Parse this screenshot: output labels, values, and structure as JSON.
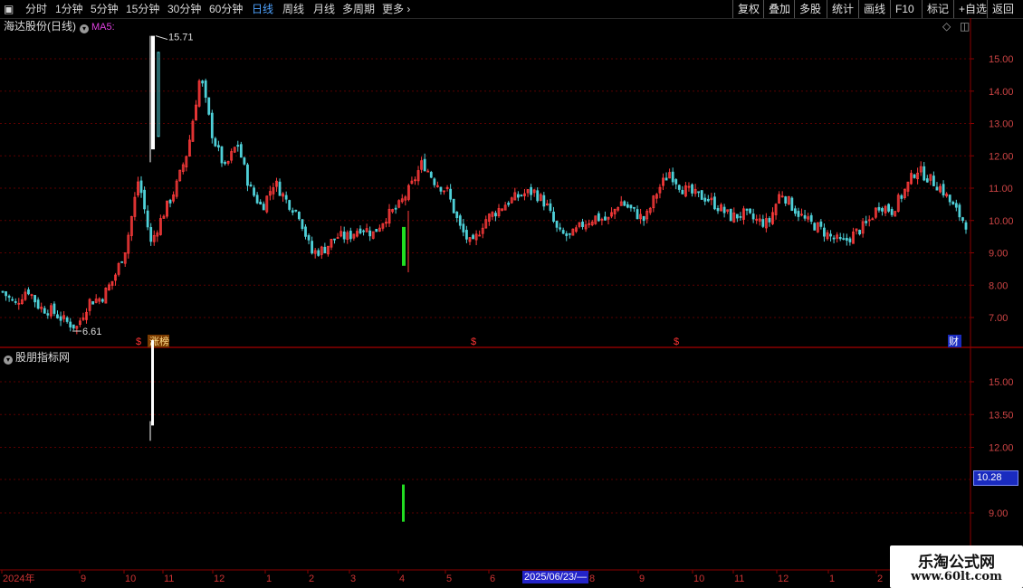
{
  "toolbar": {
    "periods": [
      "分时",
      "1分钟",
      "5分钟",
      "15分钟",
      "30分钟",
      "60分钟",
      "日线",
      "周线",
      "月线",
      "多周期"
    ],
    "active_period": "日线",
    "more_label": "更多",
    "right_buttons": [
      "复权",
      "叠加",
      "多股",
      "统计",
      "画线",
      "F10",
      "标记",
      "+自选",
      "返回"
    ]
  },
  "main_panel": {
    "title": "海达股份(日线)",
    "indicator": "MA5:",
    "high_label": "15.71",
    "low_label": "6.61",
    "y_ticks": [
      "15.00",
      "14.00",
      "13.00",
      "12.00",
      "11.00",
      "10.00",
      "9.00",
      "8.00",
      "7.00"
    ],
    "event_markers": [
      "$",
      "涨榜",
      "$",
      "$",
      "财"
    ]
  },
  "sub_panel": {
    "title": "股朋指标网",
    "y_ticks": [
      "15.00",
      "13.50",
      "12.00",
      "9.00"
    ],
    "price_tag": "10.28"
  },
  "x_axis": {
    "labels": [
      "2024年",
      "9",
      "10",
      "11",
      "12",
      "1",
      "2",
      "3",
      "4",
      "5",
      "6",
      "8",
      "9",
      "10",
      "11",
      "12",
      "1",
      "2"
    ],
    "cursor_date": "2025/06/23/—"
  },
  "colors": {
    "up": "#ff3b3b",
    "down": "#4fd0d8",
    "flat": "#ffffff",
    "limit_up": "#22dd22",
    "grid": "#5a0000",
    "axis": "#8b0000"
  },
  "watermark": {
    "line1": "乐淘公式网",
    "line2": "www.60lt.com"
  },
  "chart_data": {
    "type": "candlestick",
    "x": [
      "2024-07",
      "2024-09",
      "2024-10",
      "2024-11",
      "2024-12",
      "2025-01",
      "2025-02",
      "2025-03",
      "2025-04",
      "2025-05",
      "2025-06",
      "2025-08",
      "2025-09",
      "2025-10",
      "2025-11",
      "2025-12",
      "2026-01",
      "2026-02"
    ],
    "close_path": [
      7.8,
      7.4,
      7.9,
      7.3,
      7.2,
      6.9,
      6.7,
      7.5,
      7.6,
      8.2,
      9.2,
      11.3,
      9.3,
      10.2,
      11.0,
      12.2,
      14.5,
      12.6,
      11.6,
      12.4,
      11.0,
      10.4,
      11.2,
      10.6,
      10.2,
      9.0,
      9.1,
      9.5,
      9.5,
      9.8,
      9.6,
      10.1,
      10.4,
      11.0,
      11.8,
      11.2,
      10.9,
      9.8,
      9.2,
      10.0,
      10.3,
      10.6,
      10.8,
      10.9,
      10.5,
      9.6,
      9.5,
      9.9,
      10.1,
      10.0,
      10.6,
      10.3,
      10.0,
      10.9,
      11.5,
      11.0,
      10.8,
      10.7,
      10.4,
      10.1,
      10.2,
      10.0,
      9.9,
      10.9,
      10.4,
      10.0,
      9.8,
      9.5,
      9.3,
      9.6,
      9.9,
      10.5,
      10.3,
      10.9,
      11.6,
      11.3,
      11.0,
      10.4,
      9.9
    ],
    "high": 15.71,
    "low": 6.61,
    "ylim": [
      6.2,
      16.0
    ]
  }
}
